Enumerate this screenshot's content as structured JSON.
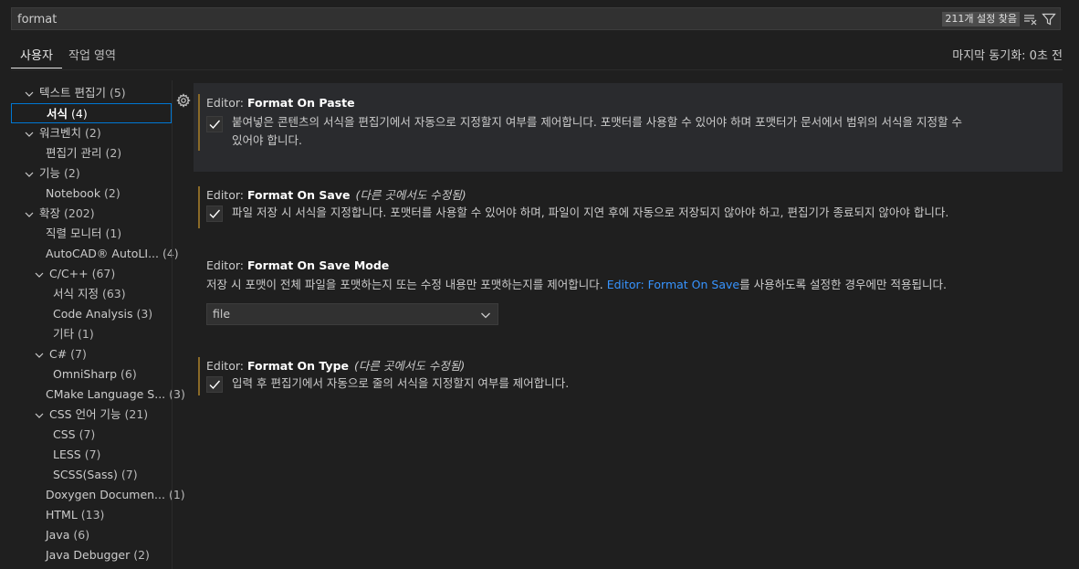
{
  "search": {
    "value": "format",
    "result_count": "211개 설정 찾음"
  },
  "tabs": {
    "user": "사용자",
    "workspace": "작업 영역"
  },
  "sync_status": "마지막 동기화: 0초 전",
  "toc": [
    {
      "name": "텍스트 편집기",
      "count": "(5)",
      "expanded": true,
      "level": 0
    },
    {
      "name": "서식",
      "count": "(4)",
      "selected": true,
      "level": 1
    },
    {
      "name": "워크벤치",
      "count": "(2)",
      "expanded": true,
      "level": 0
    },
    {
      "name": "편집기 관리",
      "count": "(2)",
      "level": 1
    },
    {
      "name": "기능",
      "count": "(2)",
      "expanded": true,
      "level": 0
    },
    {
      "name": "Notebook",
      "count": "(2)",
      "level": 1
    },
    {
      "name": "확장",
      "count": "(202)",
      "expanded": true,
      "level": 0
    },
    {
      "name": "직렬 모니터",
      "count": "(1)",
      "level": 1
    },
    {
      "name": "AutoCAD® AutoLI...",
      "count": "(4)",
      "level": 1
    },
    {
      "name": "C/C++",
      "count": "(67)",
      "expanded": true,
      "level": 1
    },
    {
      "name": "서식 지정",
      "count": "(63)",
      "level": 2
    },
    {
      "name": "Code Analysis",
      "count": "(3)",
      "level": 2
    },
    {
      "name": "기타",
      "count": "(1)",
      "level": 2
    },
    {
      "name": "C#",
      "count": "(7)",
      "expanded": true,
      "level": 1
    },
    {
      "name": "OmniSharp",
      "count": "(6)",
      "level": 2
    },
    {
      "name": "CMake Language S...",
      "count": "(3)",
      "level": 1
    },
    {
      "name": "CSS 언어 기능",
      "count": "(21)",
      "expanded": true,
      "level": 1
    },
    {
      "name": "CSS",
      "count": "(7)",
      "level": 2
    },
    {
      "name": "LESS",
      "count": "(7)",
      "level": 2
    },
    {
      "name": "SCSS(Sass)",
      "count": "(7)",
      "level": 2
    },
    {
      "name": "Doxygen Documen...",
      "count": "(1)",
      "level": 1
    },
    {
      "name": "HTML",
      "count": "(13)",
      "level": 1
    },
    {
      "name": "Java",
      "count": "(6)",
      "level": 1
    },
    {
      "name": "Java Debugger",
      "count": "(2)",
      "level": 1
    }
  ],
  "settings": {
    "format_on_paste": {
      "category": "Editor: ",
      "key": "Format On Paste",
      "checked": true,
      "desc_line1": "붙여넣은 콘텐츠의 서식을 편집기에서 자동으로 지정할지 여부를 제어합니다. 포맷터를 사용할 수 있어야 하며 포맷터가 문서에서 범위의 서식을 지정할 수",
      "desc_line2": "있어야 합니다."
    },
    "format_on_save": {
      "category": "Editor: ",
      "key": "Format On Save",
      "modified_note": "(다른 곳에서도 수정됨)",
      "checked": true,
      "desc": "파일 저장 시 서식을 지정합니다. 포맷터를 사용할 수 있어야 하며, 파일이 지연 후에 자동으로 저장되지 않아야 하고, 편집기가 종료되지 않아야 합니다."
    },
    "format_on_save_mode": {
      "category": "Editor: ",
      "key": "Format On Save Mode",
      "desc_before": "저장 시 포맷이 전체 파일을 포맷하는지 또는 수정 내용만 포맷하는지를 제어합니다. ",
      "desc_link": "Editor: Format On Save",
      "desc_after": "를 사용하도록 설정한 경우에만 적용됩니다.",
      "value": "file"
    },
    "format_on_type": {
      "category": "Editor: ",
      "key": "Format On Type",
      "modified_note": "(다른 곳에서도 수정됨)",
      "checked": true,
      "desc": "입력 후 편집기에서 자동으로 줄의 서식을 지정할지 여부를 제어합니다."
    }
  },
  "icons": {
    "clear_filter": "clear-filter-icon",
    "filter": "filter-icon",
    "gear": "gear-icon",
    "chevron_down": "chevron-down-icon",
    "check": "check-icon"
  },
  "colors": {
    "accent": "#0078d4",
    "link": "#3794ff",
    "modified_bar": "#8a6a28",
    "background": "#1f1f1f"
  }
}
